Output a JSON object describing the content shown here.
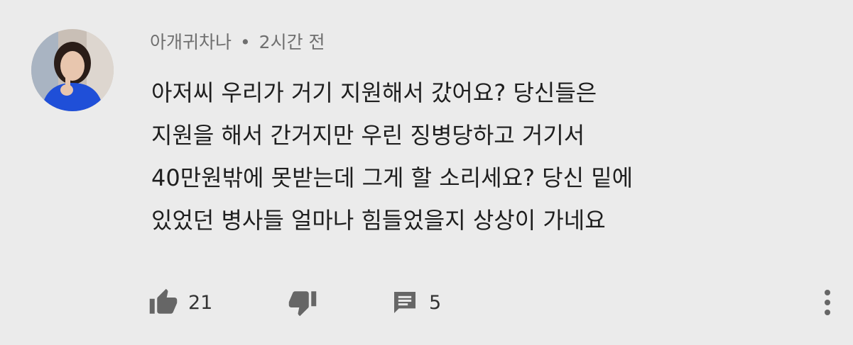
{
  "comment": {
    "author": "아개귀차나",
    "separator": "•",
    "time": "2시간 전",
    "lines": [
      "아저씨 우리가 거기 지원해서 갔어요? 당신들은",
      "지원을 해서 간거지만 우린 징병당하고 거기서",
      "40만원밖에 못받는데 그게 할 소리세요? 당신 밑에",
      "있었던 병사들 얼마나 힘들었을지 상상이 가네요"
    ],
    "likes": "21",
    "replies": "5"
  },
  "icons": {
    "like": "thumbs-up-icon",
    "dislike": "thumbs-down-icon",
    "reply": "comment-icon",
    "menu": "more-vert-icon"
  },
  "colors": {
    "background": "#ebebeb",
    "text": "#1e1e1e",
    "meta": "#6f6f6f",
    "icon": "#666666",
    "avatar_outfit": "#1f4fd8"
  }
}
